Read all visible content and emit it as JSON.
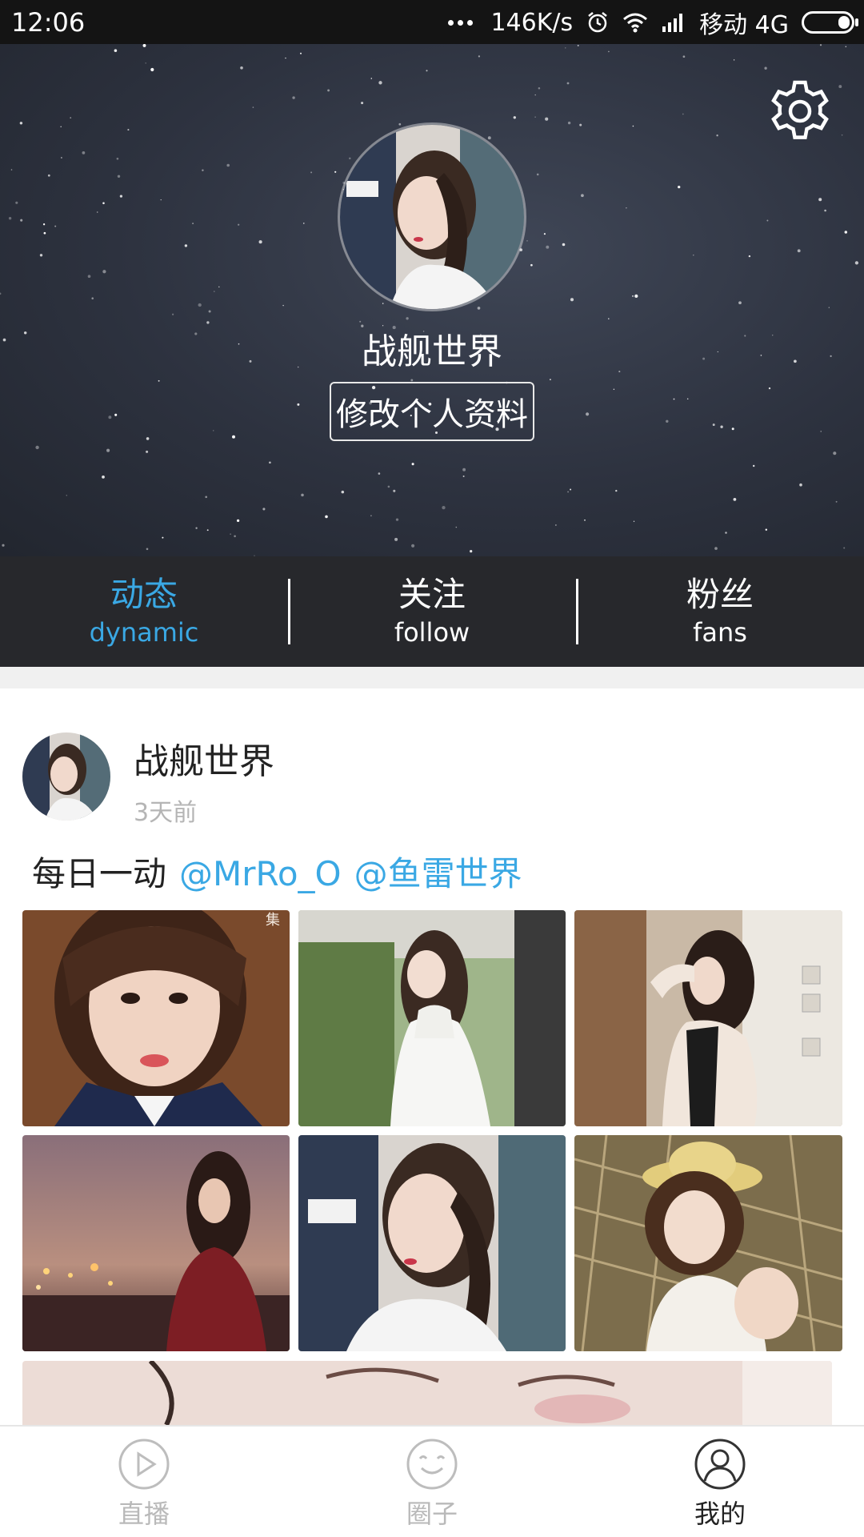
{
  "status_bar": {
    "time": "12:06",
    "speed": "146K/s",
    "carrier": "移动 4G"
  },
  "profile": {
    "name": "战舰世界",
    "edit_label": "修改个人资料"
  },
  "tabs": [
    {
      "zh": "动态",
      "en": "dynamic",
      "active": true
    },
    {
      "zh": "关注",
      "en": "follow",
      "active": false
    },
    {
      "zh": "粉丝",
      "en": "fans",
      "active": false
    }
  ],
  "post": {
    "user": "战舰世界",
    "time": "3天前",
    "text": "每日一动",
    "mentions": [
      "@MrRo_O",
      "@鱼雷世界"
    ]
  },
  "nav": [
    {
      "label": "直播",
      "icon": "play-circle-icon",
      "active": false
    },
    {
      "label": "圈子",
      "icon": "smiley-circle-icon",
      "active": false
    },
    {
      "label": "我的",
      "icon": "user-circle-icon",
      "active": true
    }
  ],
  "colors": {
    "accent": "#3aa8e4",
    "tabbar": "#27282c",
    "header": "#2d323f"
  }
}
